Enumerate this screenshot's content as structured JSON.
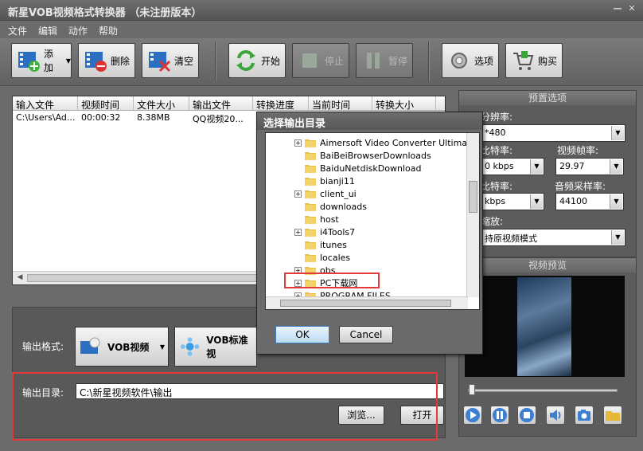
{
  "window": {
    "title": "新星VOB视频格式转换器 （未注册版本）"
  },
  "menu": [
    "文件",
    "编辑",
    "动作",
    "帮助"
  ],
  "toolbar": {
    "add": "添加",
    "delete": "删除",
    "clear": "清空",
    "start": "开始",
    "stop": "停止",
    "pause": "暂停",
    "options": "选项",
    "buy": "购买"
  },
  "filelist": {
    "columns": [
      "输入文件",
      "视频时间",
      "文件大小",
      "输出文件",
      "转换进度",
      "当前时间",
      "转换大小"
    ],
    "rows": [
      {
        "input": "C:\\Users\\Ad...",
        "duration": "00:00:32",
        "size": "8.38MB",
        "output": "QQ视频20..."
      }
    ]
  },
  "output": {
    "format_label": "输出格式:",
    "format_value": "VOB视频",
    "format_quality": "VOB标准视",
    "dir_label": "输出目录:",
    "dir_value": "C:\\新星视频软件\\输出",
    "browse": "浏览...",
    "open": "打开"
  },
  "preset": {
    "header": "预置选项",
    "resolution_label": "分辨率:",
    "resolution_value": "*480",
    "vbitrate_label": "比特率:",
    "vbitrate_value": "0 kbps",
    "framerate_label": "视频帧率:",
    "framerate_value": "29.97",
    "abitrate_label": "比特率:",
    "abitrate_value": "kbps",
    "samplerate_label": "音频采样率:",
    "samplerate_value": "44100",
    "scale_label": "缩放:",
    "scale_value": "持原视频模式"
  },
  "preview": {
    "header": "视频预览"
  },
  "dialog": {
    "title": "选择输出目录",
    "items": [
      "Aimersoft Video Converter Ultimate",
      "BaiBeiBrowserDownloads",
      "BaiduNetdiskDownload",
      "bianji11",
      "client_ui",
      "downloads",
      "host",
      "i4Tools7",
      "itunes",
      "locales",
      "obs",
      "PC下载网",
      "PROGRAM FILES"
    ],
    "ok": "OK",
    "cancel": "Cancel"
  },
  "colors": {
    "highlight_red": "#e23a3a",
    "dialog_bg": "#6a6a6a"
  }
}
